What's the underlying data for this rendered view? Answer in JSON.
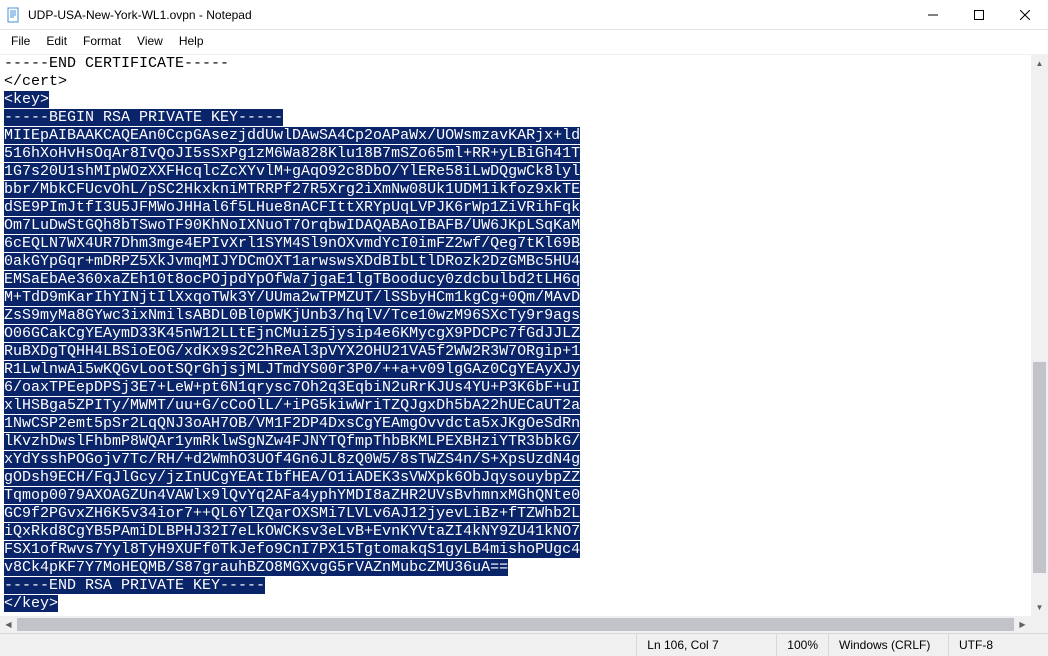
{
  "title": "UDP-USA-New-York-WL1.ovpn - Notepad",
  "menu": {
    "file": "File",
    "edit": "Edit",
    "format": "Format",
    "view": "View",
    "help": "Help"
  },
  "content": {
    "plain": [
      "-----END CERTIFICATE-----",
      "</cert>"
    ],
    "selected": [
      "<key>",
      "-----BEGIN RSA PRIVATE KEY-----",
      "MIIEpAIBAAKCAQEAn0CcpGAsezjddUwlDAwSA4Cp2oAPaWx/UOWsmzavKARjx+ld",
      "516hXoHvHsOqAr8IvQoJI5sSxPg1zM6Wa828Klu18B7mSZo65ml+RR+yLBiGh41T",
      "1G7s20U1shMIpWOzXXFHcqlcZcXYvlM+gAqO92c8DbO/YlERe58iLwDQgwCk8lyl",
      "bbr/MbkCFUcvOhL/pSC2HkxkniMTRRPf27R5Xrg2iXmNw08Uk1UDM1ikfoz9xkTE",
      "dSE9PImJtfI3U5JFMWoJHHal6f5LHue8nACFIttXRYpUqLVPJK6rWp1ZiVRihFqk",
      "Om7LuDwStGQh8bTSwoTF90KhNoIXNuoT7OrqbwIDAQABAoIBAFB/UW6JKpLSqKaM",
      "6cEQLN7WX4UR7Dhm3mge4EPIvXrl1SYM4Sl9nOXvmdYcI0imFZ2wf/Qeg7tKl69B",
      "0akGYpGqr+mDRPZ5XkJvmqMIJYDCmOXT1arwswsXDdBIbLtlDRozk2DzGMBc5HU4",
      "EMSaEbAe360xaZEh10t8ocPOjpdYpOfWa7jgaE1lgTBooducy0zdcbulbd2tLH6q",
      "M+TdD9mKarIhYINjtIlXxqoTWk3Y/UUma2wTPMZUT/lSSbyHCm1kgCg+0Qm/MAvD",
      "ZsS9myMa8GYwc3ixNmilsABDL0Bl0pWKjUnb3/hqlV/Tce10wzM96SXcTy9r9ags",
      "O06GCakCgYEAymD33K45nW12LLtEjnCMuiz5jysip4e6KMycgX9PDCPc7fGdJJLZ",
      "RuBXDgTQHH4LBSioEOG/xdKx9s2C2hReAl3pVYX2OHU21VA5f2WW2R3W7ORgip+1",
      "R1LwlnwAi5wKQGvLootSQrGhjsjMLJTmdYS00r3P0/++a+v09lgGAz0CgYEAyXJy",
      "6/oaxTPEepDPSj3E7+LeW+pt6N1qrysc7Oh2q3EqbiN2uRrKJUs4YU+P3K6bF+uI",
      "xlHSBga5ZPITy/MWMT/uu+G/cCoOlL/+iPG5kiwWriTZQJgxDh5bA22hUECaUT2a",
      "1NwCSP2emt5pSr2LqQNJ3oAH7OB/VM1F2DP4DxsCgYEAmgOvvdcta5xJKgOeSdRn",
      "lKvzhDwslFhbmP8WQAr1ymRklwSgNZw4FJNYTQfmpThbBKMLPEXBHziYTR3bbkG/",
      "xYdYsshPOGojv7Tc/RH/+d2WmhO3UOf4Gn6JL8zQ0W5/8sTWZS4n/S+XpsUzdN4g",
      "gODsh9ECH/FqJlGcy/jzInUCgYEAtIbfHEA/O1iADEK3sVWXpk6ObJqysouybpZZ",
      "Tqmop0079AXOAGZUn4VAWlx9lQvYq2AFa4yphYMDI8aZHR2UVsBvhmnxMGhQNte0",
      "GC9f2PGvxZH6K5v34ior7++QL6YlZQarOXSMi7LVLv6AJ12jyevLiBz+fTZWhb2L",
      "iQxRkd8CgYB5PAmiDLBPHJ32I7eLkOWCKsv3eLvB+EvnKYVtaZI4kNY9ZU41kNO7",
      "FSX1ofRwvs7Yyl8TyH9XUFf0TkJefo9CnI7PX15TgtomakqS1gyLB4mishoPUgc4",
      "v8Ck4pKF7Y7MoHEQMB/S87grauhBZO8MGXvgG5rVAZnMubcZMU36uA==",
      "-----END RSA PRIVATE KEY-----",
      "</key>"
    ]
  },
  "status": {
    "position": "Ln 106, Col 7",
    "zoom": "100%",
    "eol": "Windows (CRLF)",
    "encoding": "UTF-8"
  }
}
